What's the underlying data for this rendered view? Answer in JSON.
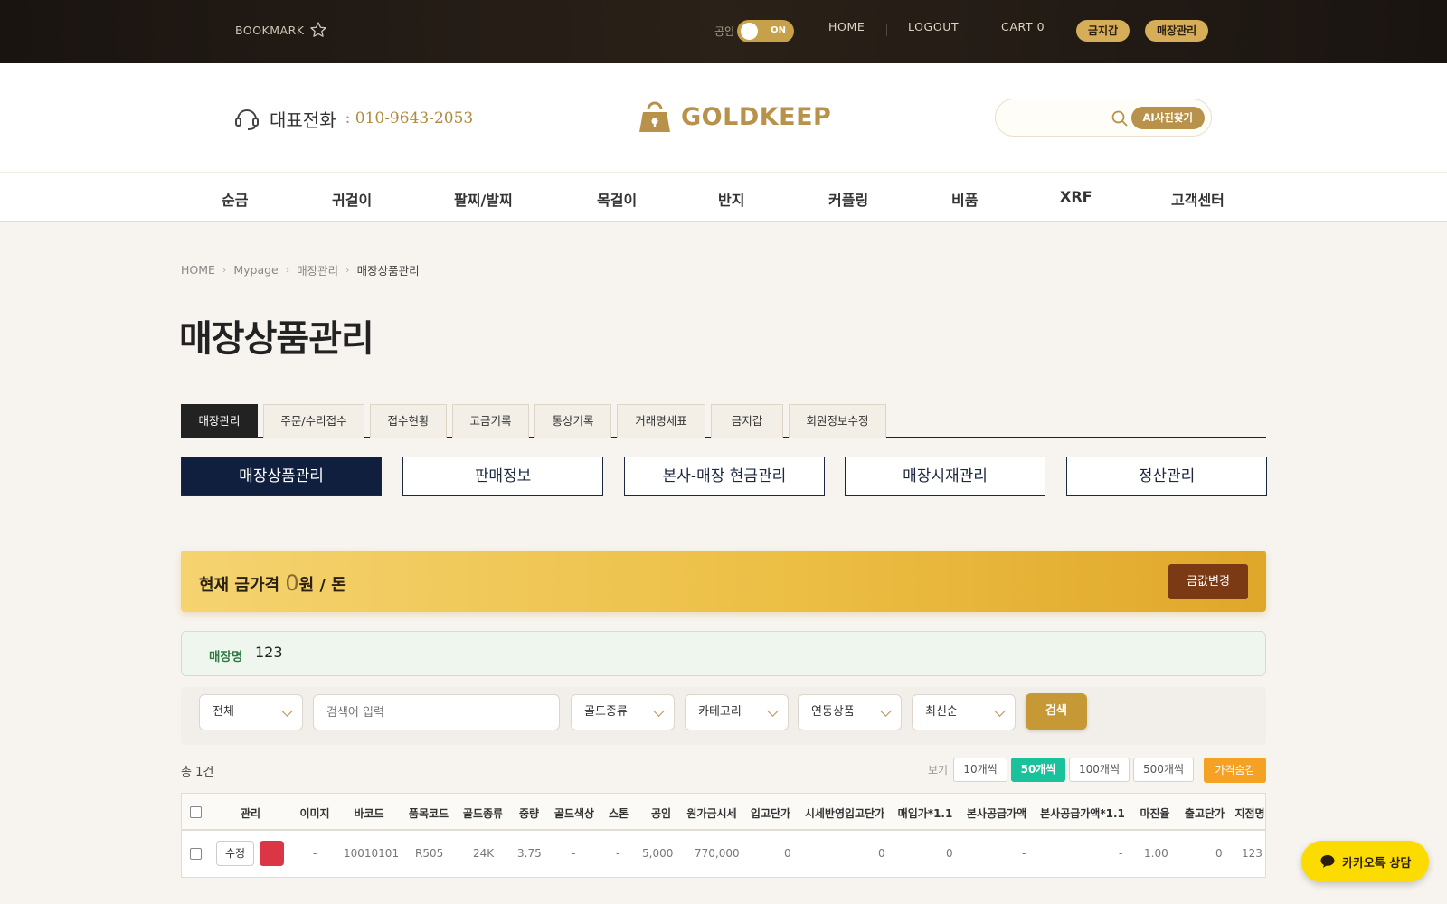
{
  "topbar": {
    "bookmark": "BOOKMARK",
    "gongim_label": "공임",
    "toggle_state": "ON",
    "nav": [
      "HOME",
      "LOGOUT",
      "CART 0"
    ],
    "pills": [
      "금지갑",
      "매장관리"
    ]
  },
  "header": {
    "phone_label": "대표전화",
    "phone_number": ": 010-9643-2053",
    "logo": "GOLDKEEP",
    "ai_button": "AI사진찾기",
    "search_placeholder": ""
  },
  "gnb": [
    "순금",
    "귀걸이",
    "팔찌/발찌",
    "목걸이",
    "반지",
    "커플링",
    "비품",
    "XRF",
    "고객센터"
  ],
  "breadcrumb": [
    "HOME",
    "Mypage",
    "매장관리",
    "매장상품관리"
  ],
  "page_title": "매장상품관리",
  "tabs": [
    "매장관리",
    "주문/수리접수",
    "접수현황",
    "고금기록",
    "통상기록",
    "거래명세표",
    "금지갑",
    "회원정보수정"
  ],
  "subtabs": [
    "매장상품관리",
    "판매정보",
    "본사-매장 현금관리",
    "매장시재관리",
    "정산관리"
  ],
  "gold_price": {
    "prefix": "현재 금가격",
    "value": "0",
    "suffix": "원 / 돈",
    "change_button": "금값변경"
  },
  "store": {
    "label": "매장명",
    "value": "123"
  },
  "filter": {
    "scope": "전체",
    "search_placeholder": "검색어 입력",
    "gold_type": "골드종류",
    "category": "카테고리",
    "linked": "연동상품",
    "sort": "최신순",
    "search_button": "검색"
  },
  "list": {
    "total": "총 1건",
    "view_label": "보기",
    "page_sizes": [
      "10개씩",
      "50개씩",
      "100개씩",
      "500개씩"
    ],
    "active_page_size": "50개씩",
    "hide_price": "가격숨김"
  },
  "table": {
    "headers": [
      "관리",
      "이미지",
      "바코드",
      "품목코드",
      "골드종류",
      "중량",
      "골드색상",
      "스톤",
      "공임",
      "원가금시세",
      "입고단가",
      "시세반영입고단가",
      "매입가*1.1",
      "본사공급가액",
      "본사공급가액*1.1",
      "마진율",
      "출고단가",
      "지점명"
    ],
    "rows": [
      {
        "edit": "수정",
        "image": "-",
        "barcode": "10010101",
        "item_code": "R505",
        "gold_type": "24K",
        "weight": "3.75",
        "gold_color": "-",
        "stone": "-",
        "labor": "5,000",
        "cost_gold_price": "770,000",
        "in_price": "0",
        "in_price_adj": "0",
        "buy_price": "0",
        "supply": "-",
        "supply_tax": "-",
        "margin": "1.00",
        "out_price": "0",
        "branch": "123"
      }
    ]
  },
  "kakao": "카카오톡 상담",
  "colors": {
    "gold": "#c79836",
    "navy": "#0f1f3d",
    "green_active": "#19c29a",
    "orange": "#f4a124",
    "brown_btn": "#7c3a14"
  }
}
